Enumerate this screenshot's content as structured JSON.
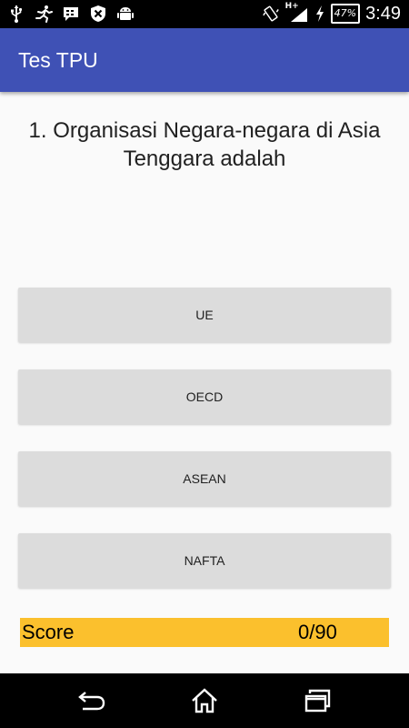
{
  "status_bar": {
    "left_icons": [
      "usb-icon",
      "running-man-icon",
      "bbm-icon",
      "x-shield-icon",
      "android-debug-icon"
    ],
    "right_icons": [
      "vibrate-icon",
      "signal-hplus-icon",
      "charging-icon",
      "battery-icon"
    ],
    "network_type": "H+",
    "battery_level": "47%",
    "time": "3:49"
  },
  "app_bar": {
    "title": "Tes TPU",
    "color": "#3f51b5"
  },
  "quiz": {
    "question": "1. Organisasi Negara-negara di Asia Tenggara adalah",
    "answers": [
      {
        "label": "UE"
      },
      {
        "label": "OECD"
      },
      {
        "label": "ASEAN"
      },
      {
        "label": "NAFTA"
      }
    ]
  },
  "score": {
    "label": "Score",
    "value": "0/90",
    "color": "#fbc02d"
  },
  "nav_bar": {
    "buttons": [
      "back-icon",
      "home-icon",
      "recents-icon"
    ]
  }
}
